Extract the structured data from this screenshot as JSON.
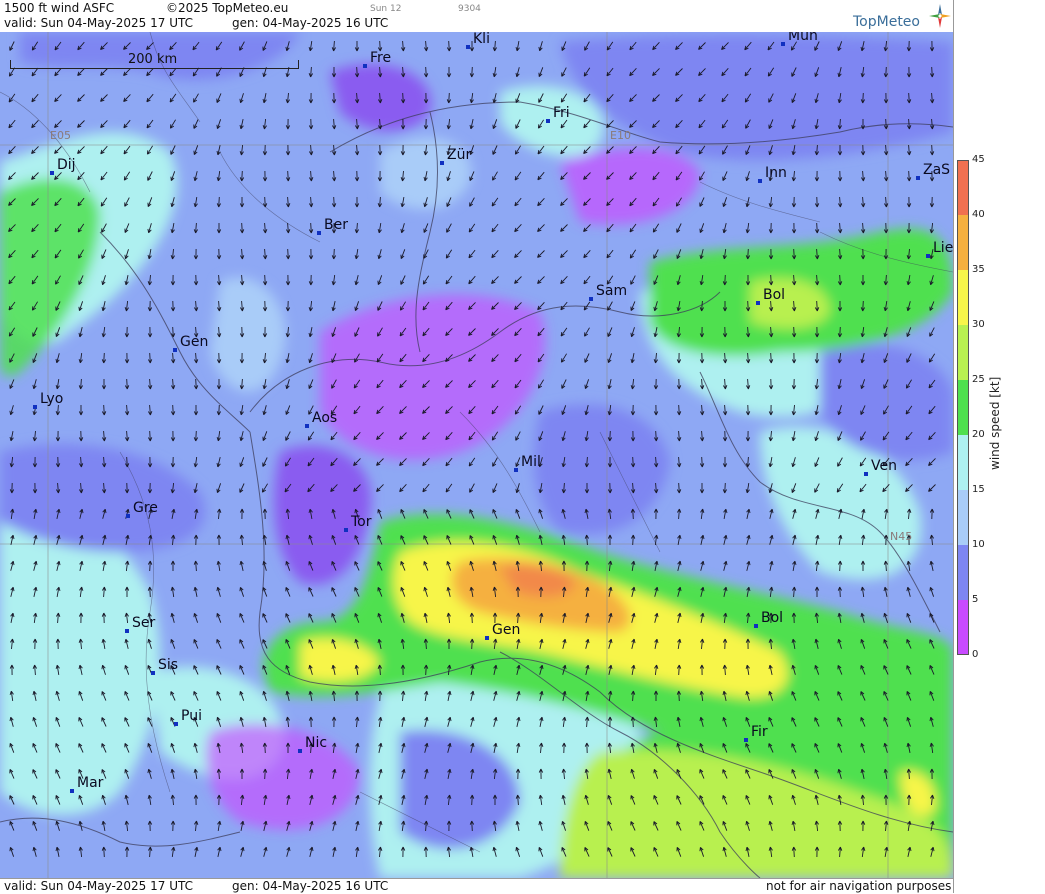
{
  "header": {
    "product": "1500 ft wind ASFC",
    "copyright": "©2025 TopMeteo.eu",
    "run_info": "Sun 12",
    "code": "9304",
    "valid": "valid:  Sun  04-May-2025  17 UTC",
    "generated": "gen: 04-May-2025 16 UTC",
    "brand": "TopMeteo"
  },
  "footer": {
    "valid": "valid:  Sun  04-May-2025  17 UTC",
    "generated": "gen: 04-May-2025 16 UTC",
    "disclaimer": "not for air navigation purposes"
  },
  "map": {
    "scale_label": "200 km",
    "grid_labels": [
      "E05",
      "E10",
      "N45"
    ],
    "cities": [
      {
        "name": "Kli"
      },
      {
        "name": "Mün"
      },
      {
        "name": "Fre"
      },
      {
        "name": "Fri"
      },
      {
        "name": "Dij"
      },
      {
        "name": "Zür"
      },
      {
        "name": "Inn"
      },
      {
        "name": "ZaS"
      },
      {
        "name": "Ber"
      },
      {
        "name": "Lie"
      },
      {
        "name": "Sam"
      },
      {
        "name": "Bol"
      },
      {
        "name": "Gen"
      },
      {
        "name": "Lyo"
      },
      {
        "name": "Aos"
      },
      {
        "name": "Mil"
      },
      {
        "name": "Ven"
      },
      {
        "name": "Gre"
      },
      {
        "name": "Tor"
      },
      {
        "name": "Gen"
      },
      {
        "name": "Bol"
      },
      {
        "name": "Ser"
      },
      {
        "name": "Sis"
      },
      {
        "name": "Pui"
      },
      {
        "name": "Nic"
      },
      {
        "name": "Fir"
      },
      {
        "name": "Mar"
      }
    ]
  },
  "legend": {
    "unit_label": "wind speed [kt]",
    "ticks": [
      "45",
      "40",
      "35",
      "30",
      "25",
      "20",
      "15",
      "10",
      "5",
      "0"
    ],
    "colors": [
      "#c84bff",
      "#8a5cf0",
      "#7e86f2",
      "#a9ccf8",
      "#aef0f0",
      "#4fe04f",
      "#b8f050",
      "#f7f54a",
      "#f5b040",
      "#f07050"
    ]
  }
}
